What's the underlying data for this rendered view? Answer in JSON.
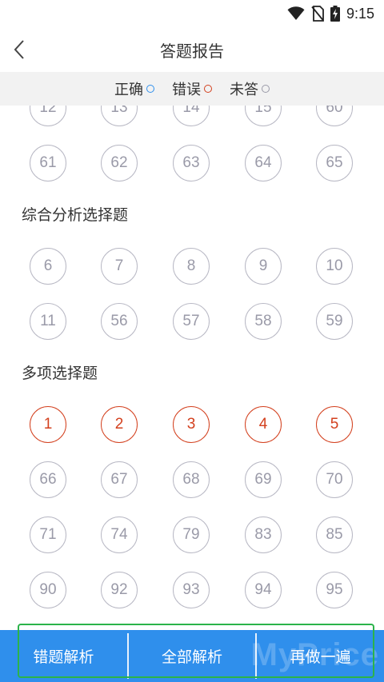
{
  "status_bar": {
    "time": "9:15",
    "icons": [
      "wifi-icon",
      "no-sim-icon",
      "battery-charging-icon"
    ]
  },
  "header": {
    "title": "答题报告",
    "back_icon": "chevron-left-icon"
  },
  "legend": [
    {
      "label": "正确",
      "color": "#2f8fec"
    },
    {
      "label": "错误",
      "color": "#d3401e"
    },
    {
      "label": "未答",
      "color": "#9a9aa8"
    }
  ],
  "sections": [
    {
      "title": "",
      "rows": [
        [
          "12",
          "13",
          "14",
          "15",
          "60"
        ],
        [
          "61",
          "62",
          "63",
          "64",
          "65"
        ]
      ],
      "wrong": []
    },
    {
      "title": "综合分析选择题",
      "rows": [
        [
          "6",
          "7",
          "8",
          "9",
          "10"
        ],
        [
          "11",
          "56",
          "57",
          "58",
          "59"
        ]
      ],
      "wrong": []
    },
    {
      "title": "多项选择题",
      "rows": [
        [
          "1",
          "2",
          "3",
          "4",
          "5"
        ],
        [
          "66",
          "67",
          "68",
          "69",
          "70"
        ],
        [
          "71",
          "74",
          "79",
          "83",
          "85"
        ],
        [
          "90",
          "92",
          "93",
          "94",
          "95"
        ]
      ],
      "wrong": [
        "1",
        "2",
        "3",
        "4",
        "5"
      ]
    }
  ],
  "bottom_bar": {
    "wrong_analysis": "错题解析",
    "all_analysis": "全部解析",
    "redo": "再做一遍"
  },
  "watermark": "MyPrice",
  "colors": {
    "accent": "#2f8fec",
    "wrong": "#d3401e",
    "unanswered": "#9a9aa8",
    "highlight": "#2bb34a"
  }
}
